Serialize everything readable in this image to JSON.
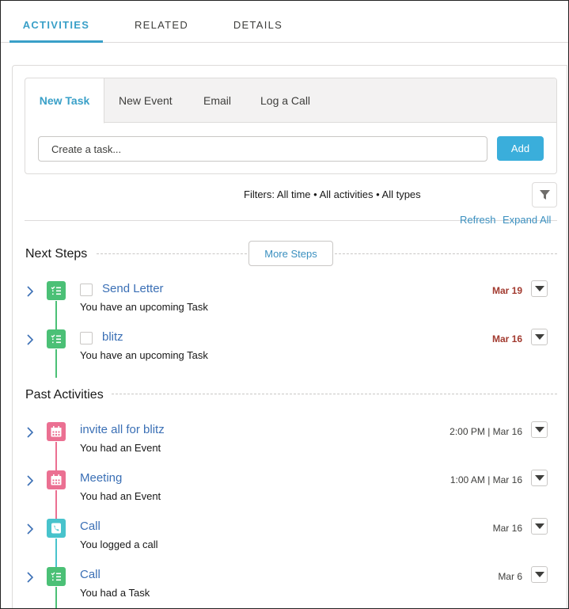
{
  "top_tabs": [
    {
      "label": "ACTIVITIES",
      "active": true
    },
    {
      "label": "RELATED",
      "active": false
    },
    {
      "label": "DETAILS",
      "active": false
    }
  ],
  "composer": {
    "tabs": [
      {
        "label": "New Task",
        "active": true
      },
      {
        "label": "New Event",
        "active": false
      },
      {
        "label": "Email",
        "active": false
      },
      {
        "label": "Log a Call",
        "active": false
      }
    ],
    "input_placeholder": "Create a task...",
    "input_value": "",
    "add_label": "Add"
  },
  "filters": {
    "text": "Filters: All time • All activities • All types",
    "refresh_label": "Refresh",
    "expand_all_label": "Expand All"
  },
  "next_steps": {
    "heading": "Next Steps",
    "more_label": "More Steps",
    "items": [
      {
        "title": "Send Letter",
        "subtitle": "You have an upcoming Task",
        "date": "Mar 19",
        "icon": "task-icon"
      },
      {
        "title": "blitz",
        "subtitle": "You have an upcoming Task",
        "date": "Mar 16",
        "icon": "task-icon"
      }
    ]
  },
  "past_activities": {
    "heading": "Past Activities",
    "items": [
      {
        "title": "invite all for blitz",
        "subtitle": "You had an Event",
        "date": "2:00 PM | Mar 16",
        "icon": "event-icon"
      },
      {
        "title": "Meeting",
        "subtitle": "You had an Event",
        "date": "1:00 AM | Mar 16",
        "icon": "event-icon"
      },
      {
        "title": "Call",
        "subtitle": "You logged a call",
        "date": "Mar 16",
        "icon": "call-icon"
      },
      {
        "title": "Call",
        "subtitle": "You had a Task",
        "date": "Mar 6",
        "icon": "task-icon"
      }
    ]
  },
  "colors": {
    "accent": "#3aa0c8",
    "task": "#4bc076",
    "event": "#eb7092",
    "call": "#48c3cc",
    "overdue": "#a23a2f"
  }
}
